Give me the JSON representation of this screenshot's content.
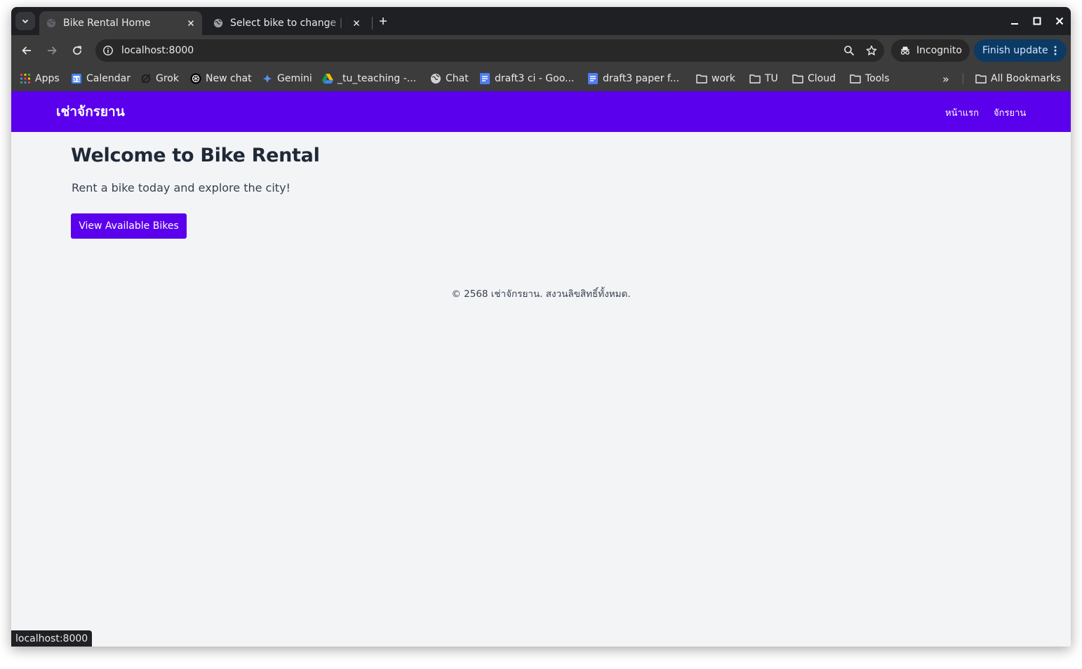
{
  "browser": {
    "tabs": [
      {
        "title": "Bike Rental Home",
        "active": true
      },
      {
        "title": "Select bike to change | Django",
        "active": false
      }
    ],
    "address": "localhost:8000",
    "incognito_label": "Incognito",
    "update_label": "Finish update",
    "bookmarks": [
      {
        "label": "Apps",
        "icon": "apps-grid-icon"
      },
      {
        "label": "Calendar",
        "icon": "calendar-icon"
      },
      {
        "label": "Grok",
        "icon": "grok-icon"
      },
      {
        "label": "New chat",
        "icon": "chatgpt-icon"
      },
      {
        "label": "Gemini",
        "icon": "gemini-sparkle-icon"
      },
      {
        "label": "_tu_teaching -...",
        "icon": "google-drive-icon"
      },
      {
        "label": "Chat",
        "icon": "globe-icon"
      },
      {
        "label": "draft3 ci - Goo...",
        "icon": "google-docs-icon"
      },
      {
        "label": "draft3 paper f...",
        "icon": "google-docs-icon"
      },
      {
        "label": "work",
        "icon": "folder-icon"
      },
      {
        "label": "TU",
        "icon": "folder-icon"
      },
      {
        "label": "Cloud",
        "icon": "folder-icon"
      },
      {
        "label": "Tools",
        "icon": "folder-icon"
      }
    ],
    "overflow_label": "»",
    "all_bookmarks_label": "All Bookmarks",
    "status_url": "localhost:8000"
  },
  "site": {
    "brand": "เช่าจักรยาน",
    "nav": [
      {
        "label": "หน้าแรก"
      },
      {
        "label": "จักรยาน"
      }
    ],
    "heading": "Welcome to Bike Rental",
    "subtitle": "Rent a bike today and explore the city!",
    "cta_label": "View Available Bikes",
    "footer": "© 2568 เช่าจักรยาน. สงวนลิขสิทธิ์ทั้งหมด."
  },
  "colors": {
    "brand_primary": "#5b00ec",
    "page_background": "#f3f4f6",
    "heading_text": "#1f2937",
    "browser_frame": "#3c3c3c"
  }
}
